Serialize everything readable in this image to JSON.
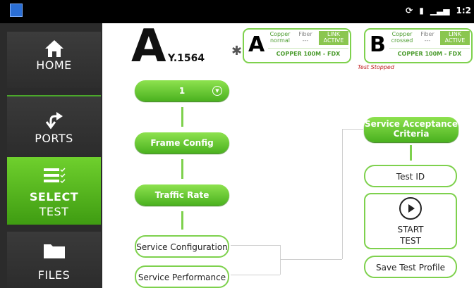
{
  "status": {
    "time": "1:2"
  },
  "sidebar": {
    "items": [
      {
        "label": "HOME",
        "icon": "home-icon"
      },
      {
        "label": "PORTS",
        "icon": "ports-icon"
      },
      {
        "label_line1": "SELECT",
        "label_line2": "TEST",
        "icon": "checklist-icon",
        "active": true
      },
      {
        "label": "FILES",
        "icon": "folder-icon"
      }
    ]
  },
  "header": {
    "port_letter": "A",
    "test_name": "Y.1564"
  },
  "port_a": {
    "letter": "A",
    "copper_line1": "Copper",
    "copper_line2": "normal",
    "fiber_line1": "Fiber",
    "fiber_line2": "---",
    "link_line1": "LINK",
    "link_line2": "ACTIVE",
    "speed": "COPPER 100M  - FDX"
  },
  "port_b": {
    "letter": "B",
    "copper_line1": "Copper",
    "copper_line2": "crossed",
    "fiber_line1": "Fiber",
    "fiber_line2": "---",
    "link_line1": "LINK",
    "link_line2": "ACTIVE",
    "speed": "COPPER 100M  - FDX"
  },
  "test_status": "Test Stopped",
  "flow": {
    "service_selector": "1",
    "frame_config": "Frame Config",
    "traffic_rate": "Traffic Rate",
    "service_configuration": "Service Configuration",
    "service_performance": "Service Performance"
  },
  "right": {
    "sac_line1": "Service Acceptance",
    "sac_line2": "Criteria",
    "test_id": "Test ID",
    "start_line1": "START",
    "start_line2": "TEST",
    "save_profile": "Save Test Profile"
  },
  "colors": {
    "accent": "#5cc22a",
    "sidebar_bg": "#2b2b2b",
    "stopped": "#c02222"
  }
}
